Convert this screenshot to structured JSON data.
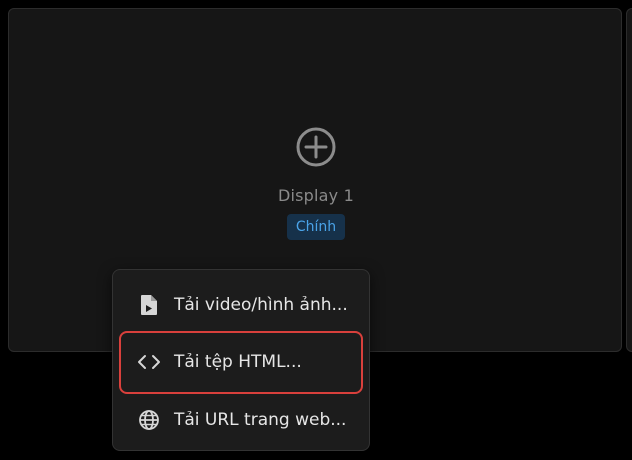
{
  "display": {
    "label": "Display 1",
    "badge": "Chính"
  },
  "menu": {
    "items": [
      {
        "label": "Tải video/hình ảnh...",
        "icon": "file-media-icon"
      },
      {
        "label": "Tải tệp HTML...",
        "icon": "code-icon"
      },
      {
        "label": "Tải URL trang web...",
        "icon": "globe-icon"
      }
    ]
  },
  "colors": {
    "background": "#000000",
    "card": "#161616",
    "menu": "#1c1c1c",
    "accent": "#4aa3e8",
    "badge_bg": "#16314a",
    "highlight": "#d9403c"
  }
}
